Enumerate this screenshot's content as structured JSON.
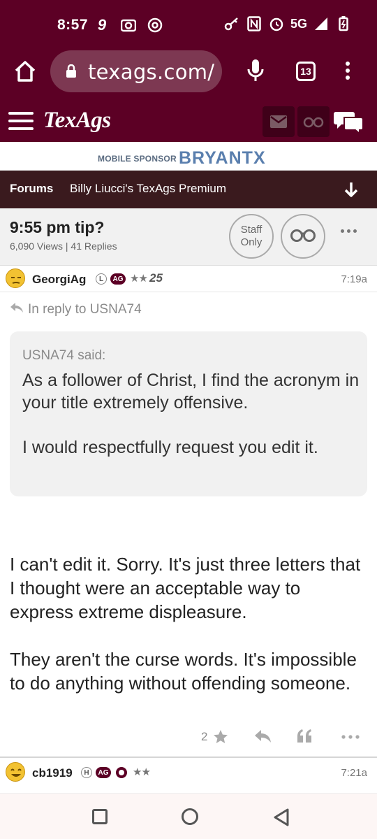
{
  "status_bar": {
    "time": "8:57",
    "network": "5G"
  },
  "browser": {
    "url": "texags.com/",
    "tab_count": "13"
  },
  "site": {
    "logo": "TexAgs"
  },
  "sponsor": {
    "label": "MOBILE SPONSOR",
    "brand": "BRYANTX"
  },
  "forum_nav": {
    "forums_label": "Forums",
    "forum_name": "Billy Liucci's TexAgs Premium"
  },
  "thread": {
    "title": "9:55 pm tip?",
    "meta": "6,090 Views | 41 Replies",
    "staff_only_label": "Staff\nOnly"
  },
  "post": {
    "username": "GeorgiAg",
    "badge_l": "L",
    "badge_ag": "AG",
    "stars": "★★",
    "rank": "25",
    "time": "7:19a",
    "reply_to": "In reply to USNA74",
    "quote_author": "USNA74 said:",
    "quote_text": "As a follower of Christ, I find the acronym in your title extremely offensive.\n\nI would respectfully request you edit it.",
    "body": "I can't edit it. Sorry. It's just three letters that I thought were an acceptable way to express extreme displeasure.\n\nThey aren't the curse words. It's impossible to do anything without offending someone.",
    "like_count": "2"
  },
  "next_post": {
    "username": "cb1919",
    "badge_h": "H",
    "badge_ag": "AG",
    "stars": "★★",
    "time": "7:21a"
  },
  "colors": {
    "maroon": "#5c0025",
    "dark_nav": "#3a1a1e"
  }
}
